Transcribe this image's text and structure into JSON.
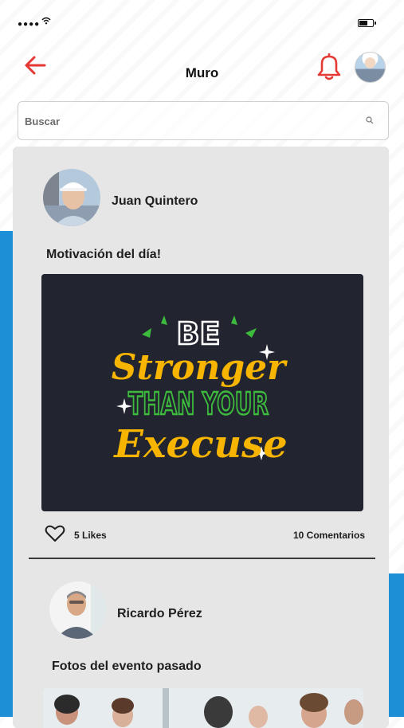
{
  "header": {
    "title": "Muro"
  },
  "search": {
    "placeholder": "Buscar"
  },
  "posts": [
    {
      "author": "Juan Quintero",
      "caption": "Motivación del día!",
      "image_text": {
        "line1": "BE",
        "line2": "Stronger",
        "line3": "THAN YOUR",
        "line4": "Execuse"
      },
      "likes": "5 Likes",
      "comments": "10 Comentarios"
    },
    {
      "author": "Ricardo Pérez",
      "caption": "Fotos del evento pasado"
    }
  ],
  "colors": {
    "accent_red": "#e53935",
    "blue": "#1c8fd6",
    "image_bg": "#22252f",
    "yellow": "#f7b500",
    "green": "#3dbb3d"
  },
  "icons": [
    "back-arrow-icon",
    "bell-icon",
    "search-icon",
    "heart-icon"
  ]
}
